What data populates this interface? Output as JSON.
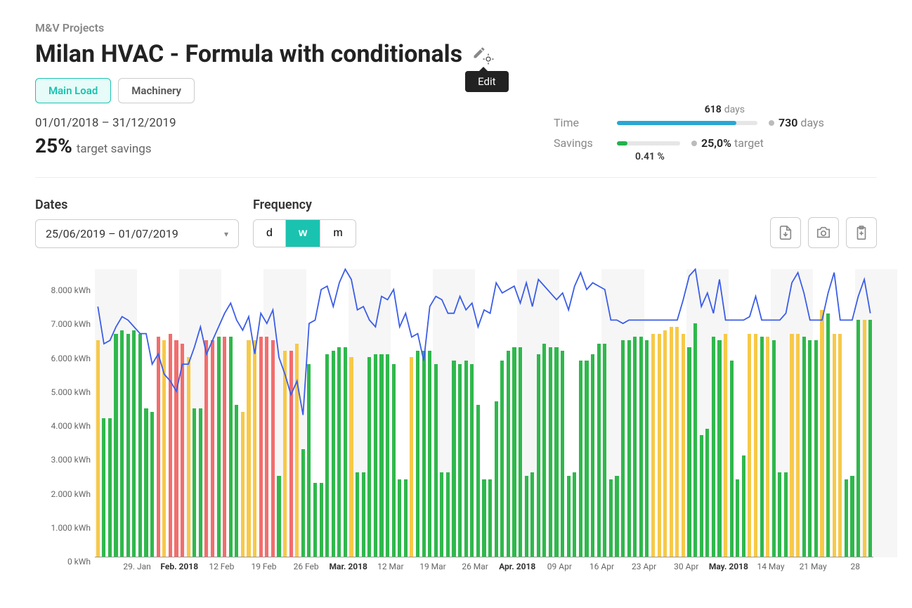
{
  "breadcrumb": "M&V Projects",
  "title": "Milan HVAC - Formula with conditionals",
  "edit_tooltip": "Edit",
  "tabs": [
    {
      "label": "Main Load",
      "active": true
    },
    {
      "label": "Machinery",
      "active": false
    }
  ],
  "date_range": "01/01/2018 – 31/12/2019",
  "target_savings_value": "25%",
  "target_savings_label": "target savings",
  "stats": {
    "time": {
      "label": "Time",
      "elapsed_value": "618",
      "elapsed_unit": "days",
      "total_value": "730",
      "total_unit": "days",
      "progress_pct": 85
    },
    "savings": {
      "label": "Savings",
      "actual_value": "0.41 %",
      "target_value": "25,0%",
      "target_unit": "target",
      "progress_pct": 17
    }
  },
  "controls": {
    "dates_label": "Dates",
    "dates_value": "25/06/2019 – 01/07/2019",
    "freq_label": "Frequency",
    "freq_options": [
      {
        "value": "d",
        "label": "d",
        "active": false
      },
      {
        "value": "w",
        "label": "w",
        "active": true
      },
      {
        "value": "m",
        "label": "m",
        "active": false
      }
    ]
  },
  "chart_data": {
    "type": "bar",
    "ylabel": "kWh",
    "ylim": [
      0,
      8500
    ],
    "y_ticks": [
      0,
      1000,
      2000,
      3000,
      4000,
      5000,
      6000,
      7000,
      8000
    ],
    "y_tick_format": "{v}.000 kWh",
    "x_ticks": [
      {
        "label": "29. Jan",
        "i": 7
      },
      {
        "label": "Feb. 2018",
        "i": 14,
        "bold": true
      },
      {
        "label": "12 Feb",
        "i": 21
      },
      {
        "label": "19 Feb",
        "i": 28
      },
      {
        "label": "26 Feb",
        "i": 35
      },
      {
        "label": "Mar. 2018",
        "i": 42,
        "bold": true
      },
      {
        "label": "12 Mar",
        "i": 49
      },
      {
        "label": "19 Mar",
        "i": 56
      },
      {
        "label": "26 Mar",
        "i": 63
      },
      {
        "label": "Apr. 2018",
        "i": 70,
        "bold": true
      },
      {
        "label": "09 Apr",
        "i": 77
      },
      {
        "label": "16 Apr",
        "i": 84
      },
      {
        "label": "23 Apr",
        "i": 91
      },
      {
        "label": "30 Apr",
        "i": 98
      },
      {
        "label": "May. 2018",
        "i": 105,
        "bold": true
      },
      {
        "label": "14 May",
        "i": 112
      },
      {
        "label": "21 May",
        "i": 119
      },
      {
        "label": "28",
        "i": 126
      }
    ],
    "bars": [
      {
        "v": 6400,
        "c": "amber"
      },
      {
        "v": 4100,
        "c": "green"
      },
      {
        "v": 4100,
        "c": "green"
      },
      {
        "v": 6600,
        "c": "green"
      },
      {
        "v": 6700,
        "c": "green"
      },
      {
        "v": 6600,
        "c": "green"
      },
      {
        "v": 6700,
        "c": "green"
      },
      {
        "v": 6600,
        "c": "green"
      },
      {
        "v": 4400,
        "c": "green"
      },
      {
        "v": 4300,
        "c": "green"
      },
      {
        "v": 6500,
        "c": "red"
      },
      {
        "v": 6400,
        "c": "amber"
      },
      {
        "v": 6600,
        "c": "red"
      },
      {
        "v": 6400,
        "c": "red"
      },
      {
        "v": 6300,
        "c": "red"
      },
      {
        "v": 5900,
        "c": "amber"
      },
      {
        "v": 4400,
        "c": "green"
      },
      {
        "v": 4400,
        "c": "green"
      },
      {
        "v": 6400,
        "c": "red"
      },
      {
        "v": 6400,
        "c": "red"
      },
      {
        "v": 6500,
        "c": "green"
      },
      {
        "v": 6500,
        "c": "red"
      },
      {
        "v": 6500,
        "c": "green"
      },
      {
        "v": 4500,
        "c": "green"
      },
      {
        "v": 4300,
        "c": "amber"
      },
      {
        "v": 6400,
        "c": "amber"
      },
      {
        "v": 6400,
        "c": "amber"
      },
      {
        "v": 6500,
        "c": "red"
      },
      {
        "v": 6500,
        "c": "red"
      },
      {
        "v": 6400,
        "c": "red"
      },
      {
        "v": 2400,
        "c": "green"
      },
      {
        "v": 6100,
        "c": "amber"
      },
      {
        "v": 6100,
        "c": "red"
      },
      {
        "v": 6300,
        "c": "amber"
      },
      {
        "v": 3200,
        "c": "green"
      },
      {
        "v": 5700,
        "c": "green"
      },
      {
        "v": 2200,
        "c": "green"
      },
      {
        "v": 2200,
        "c": "green"
      },
      {
        "v": 6000,
        "c": "green"
      },
      {
        "v": 6100,
        "c": "green"
      },
      {
        "v": 6200,
        "c": "green"
      },
      {
        "v": 6200,
        "c": "green"
      },
      {
        "v": 5900,
        "c": "amber"
      },
      {
        "v": 2500,
        "c": "green"
      },
      {
        "v": 2500,
        "c": "green"
      },
      {
        "v": 5900,
        "c": "green"
      },
      {
        "v": 6000,
        "c": "green"
      },
      {
        "v": 6000,
        "c": "green"
      },
      {
        "v": 6000,
        "c": "green"
      },
      {
        "v": 5700,
        "c": "green"
      },
      {
        "v": 2300,
        "c": "green"
      },
      {
        "v": 2300,
        "c": "green"
      },
      {
        "v": 5900,
        "c": "amber"
      },
      {
        "v": 6100,
        "c": "green"
      },
      {
        "v": 6100,
        "c": "green"
      },
      {
        "v": 6100,
        "c": "green"
      },
      {
        "v": 5700,
        "c": "green"
      },
      {
        "v": 2500,
        "c": "green"
      },
      {
        "v": 2500,
        "c": "green"
      },
      {
        "v": 5800,
        "c": "green"
      },
      {
        "v": 5700,
        "c": "green"
      },
      {
        "v": 5800,
        "c": "green"
      },
      {
        "v": 5700,
        "c": "green"
      },
      {
        "v": 4500,
        "c": "green"
      },
      {
        "v": 2300,
        "c": "green"
      },
      {
        "v": 2300,
        "c": "green"
      },
      {
        "v": 4600,
        "c": "green"
      },
      {
        "v": 5800,
        "c": "green"
      },
      {
        "v": 6100,
        "c": "green"
      },
      {
        "v": 6200,
        "c": "green"
      },
      {
        "v": 6200,
        "c": "green"
      },
      {
        "v": 2400,
        "c": "green"
      },
      {
        "v": 2500,
        "c": "green"
      },
      {
        "v": 6000,
        "c": "green"
      },
      {
        "v": 6300,
        "c": "green"
      },
      {
        "v": 6200,
        "c": "green"
      },
      {
        "v": 6200,
        "c": "green"
      },
      {
        "v": 6100,
        "c": "green"
      },
      {
        "v": 2400,
        "c": "green"
      },
      {
        "v": 2500,
        "c": "green"
      },
      {
        "v": 5800,
        "c": "green"
      },
      {
        "v": 5800,
        "c": "green"
      },
      {
        "v": 6000,
        "c": "green"
      },
      {
        "v": 6300,
        "c": "green"
      },
      {
        "v": 6300,
        "c": "green"
      },
      {
        "v": 2300,
        "c": "green"
      },
      {
        "v": 2400,
        "c": "green"
      },
      {
        "v": 6400,
        "c": "green"
      },
      {
        "v": 6400,
        "c": "green"
      },
      {
        "v": 6500,
        "c": "green"
      },
      {
        "v": 6500,
        "c": "green"
      },
      {
        "v": 6400,
        "c": "green"
      },
      {
        "v": 6600,
        "c": "amber"
      },
      {
        "v": 6600,
        "c": "amber"
      },
      {
        "v": 6700,
        "c": "amber"
      },
      {
        "v": 6800,
        "c": "amber"
      },
      {
        "v": 6800,
        "c": "amber"
      },
      {
        "v": 6600,
        "c": "amber"
      },
      {
        "v": 6200,
        "c": "green"
      },
      {
        "v": 6900,
        "c": "green"
      },
      {
        "v": 3600,
        "c": "green"
      },
      {
        "v": 3800,
        "c": "green"
      },
      {
        "v": 6500,
        "c": "green"
      },
      {
        "v": 6400,
        "c": "green"
      },
      {
        "v": 6600,
        "c": "amber"
      },
      {
        "v": 5800,
        "c": "green"
      },
      {
        "v": 2300,
        "c": "green"
      },
      {
        "v": 3000,
        "c": "green"
      },
      {
        "v": 6600,
        "c": "amber"
      },
      {
        "v": 6600,
        "c": "amber"
      },
      {
        "v": 6500,
        "c": "green"
      },
      {
        "v": 6500,
        "c": "amber"
      },
      {
        "v": 6400,
        "c": "green"
      },
      {
        "v": 2500,
        "c": "green"
      },
      {
        "v": 2500,
        "c": "green"
      },
      {
        "v": 6600,
        "c": "amber"
      },
      {
        "v": 6600,
        "c": "amber"
      },
      {
        "v": 6500,
        "c": "green"
      },
      {
        "v": 6400,
        "c": "green"
      },
      {
        "v": 6400,
        "c": "green"
      },
      {
        "v": 7300,
        "c": "amber"
      },
      {
        "v": 7200,
        "c": "green"
      },
      {
        "v": 6600,
        "c": "amber"
      },
      {
        "v": 6600,
        "c": "amber"
      },
      {
        "v": 2300,
        "c": "green"
      },
      {
        "v": 2400,
        "c": "green"
      },
      {
        "v": 7000,
        "c": "green"
      },
      {
        "v": 7000,
        "c": "amber"
      },
      {
        "v": 7000,
        "c": "green"
      }
    ],
    "baseline": [
      7400,
      6300,
      6400,
      6800,
      7100,
      7000,
      6800,
      6600,
      6600,
      5700,
      6000,
      5400,
      5200,
      4900,
      5700,
      5700,
      6200,
      6800,
      6000,
      6400,
      6800,
      7200,
      7500,
      7000,
      6700,
      7100,
      6000,
      7200,
      6900,
      7300,
      5900,
      5400,
      4800,
      5200,
      4200,
      6900,
      7000,
      7900,
      8000,
      7400,
      8100,
      8500,
      8200,
      7300,
      7400,
      7000,
      6800,
      7700,
      7600,
      7900,
      6800,
      7200,
      6500,
      6600,
      5800,
      7400,
      7700,
      7600,
      7200,
      7200,
      7700,
      7300,
      7500,
      6800,
      7300,
      7200,
      8100,
      7800,
      7900,
      8000,
      7500,
      8100,
      7400,
      8200,
      8000,
      7800,
      7600,
      7800,
      7300,
      8000,
      8400,
      7900,
      8100,
      8000,
      7900,
      7000,
      7000,
      6900,
      7000,
      7000,
      7000,
      7000,
      7000,
      7000,
      7000,
      7000,
      7000,
      7600,
      8300,
      8500,
      7400,
      7800,
      7200,
      8200,
      7000,
      7000,
      7000,
      7000,
      7100,
      7700,
      7000,
      7000,
      7000,
      7000,
      7200,
      8100,
      8400,
      7800,
      7000,
      7000,
      7000,
      7800,
      8400,
      7000,
      7000,
      7000,
      7700,
      8200,
      7200
    ]
  }
}
